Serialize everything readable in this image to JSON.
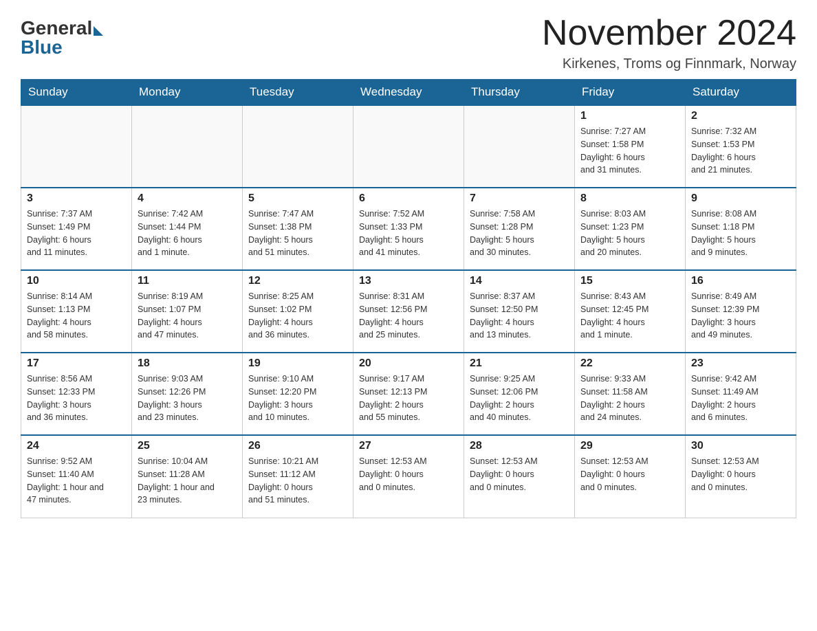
{
  "header": {
    "logo_general": "General",
    "logo_blue": "Blue",
    "month_title": "November 2024",
    "location": "Kirkenes, Troms og Finnmark, Norway"
  },
  "weekdays": [
    "Sunday",
    "Monday",
    "Tuesday",
    "Wednesday",
    "Thursday",
    "Friday",
    "Saturday"
  ],
  "weeks": [
    [
      {
        "day": "",
        "info": ""
      },
      {
        "day": "",
        "info": ""
      },
      {
        "day": "",
        "info": ""
      },
      {
        "day": "",
        "info": ""
      },
      {
        "day": "",
        "info": ""
      },
      {
        "day": "1",
        "info": "Sunrise: 7:27 AM\nSunset: 1:58 PM\nDaylight: 6 hours\nand 31 minutes."
      },
      {
        "day": "2",
        "info": "Sunrise: 7:32 AM\nSunset: 1:53 PM\nDaylight: 6 hours\nand 21 minutes."
      }
    ],
    [
      {
        "day": "3",
        "info": "Sunrise: 7:37 AM\nSunset: 1:49 PM\nDaylight: 6 hours\nand 11 minutes."
      },
      {
        "day": "4",
        "info": "Sunrise: 7:42 AM\nSunset: 1:44 PM\nDaylight: 6 hours\nand 1 minute."
      },
      {
        "day": "5",
        "info": "Sunrise: 7:47 AM\nSunset: 1:38 PM\nDaylight: 5 hours\nand 51 minutes."
      },
      {
        "day": "6",
        "info": "Sunrise: 7:52 AM\nSunset: 1:33 PM\nDaylight: 5 hours\nand 41 minutes."
      },
      {
        "day": "7",
        "info": "Sunrise: 7:58 AM\nSunset: 1:28 PM\nDaylight: 5 hours\nand 30 minutes."
      },
      {
        "day": "8",
        "info": "Sunrise: 8:03 AM\nSunset: 1:23 PM\nDaylight: 5 hours\nand 20 minutes."
      },
      {
        "day": "9",
        "info": "Sunrise: 8:08 AM\nSunset: 1:18 PM\nDaylight: 5 hours\nand 9 minutes."
      }
    ],
    [
      {
        "day": "10",
        "info": "Sunrise: 8:14 AM\nSunset: 1:13 PM\nDaylight: 4 hours\nand 58 minutes."
      },
      {
        "day": "11",
        "info": "Sunrise: 8:19 AM\nSunset: 1:07 PM\nDaylight: 4 hours\nand 47 minutes."
      },
      {
        "day": "12",
        "info": "Sunrise: 8:25 AM\nSunset: 1:02 PM\nDaylight: 4 hours\nand 36 minutes."
      },
      {
        "day": "13",
        "info": "Sunrise: 8:31 AM\nSunset: 12:56 PM\nDaylight: 4 hours\nand 25 minutes."
      },
      {
        "day": "14",
        "info": "Sunrise: 8:37 AM\nSunset: 12:50 PM\nDaylight: 4 hours\nand 13 minutes."
      },
      {
        "day": "15",
        "info": "Sunrise: 8:43 AM\nSunset: 12:45 PM\nDaylight: 4 hours\nand 1 minute."
      },
      {
        "day": "16",
        "info": "Sunrise: 8:49 AM\nSunset: 12:39 PM\nDaylight: 3 hours\nand 49 minutes."
      }
    ],
    [
      {
        "day": "17",
        "info": "Sunrise: 8:56 AM\nSunset: 12:33 PM\nDaylight: 3 hours\nand 36 minutes."
      },
      {
        "day": "18",
        "info": "Sunrise: 9:03 AM\nSunset: 12:26 PM\nDaylight: 3 hours\nand 23 minutes."
      },
      {
        "day": "19",
        "info": "Sunrise: 9:10 AM\nSunset: 12:20 PM\nDaylight: 3 hours\nand 10 minutes."
      },
      {
        "day": "20",
        "info": "Sunrise: 9:17 AM\nSunset: 12:13 PM\nDaylight: 2 hours\nand 55 minutes."
      },
      {
        "day": "21",
        "info": "Sunrise: 9:25 AM\nSunset: 12:06 PM\nDaylight: 2 hours\nand 40 minutes."
      },
      {
        "day": "22",
        "info": "Sunrise: 9:33 AM\nSunset: 11:58 AM\nDaylight: 2 hours\nand 24 minutes."
      },
      {
        "day": "23",
        "info": "Sunrise: 9:42 AM\nSunset: 11:49 AM\nDaylight: 2 hours\nand 6 minutes."
      }
    ],
    [
      {
        "day": "24",
        "info": "Sunrise: 9:52 AM\nSunset: 11:40 AM\nDaylight: 1 hour and\n47 minutes."
      },
      {
        "day": "25",
        "info": "Sunrise: 10:04 AM\nSunset: 11:28 AM\nDaylight: 1 hour and\n23 minutes."
      },
      {
        "day": "26",
        "info": "Sunrise: 10:21 AM\nSunset: 11:12 AM\nDaylight: 0 hours\nand 51 minutes."
      },
      {
        "day": "27",
        "info": "Sunset: 12:53 AM\nDaylight: 0 hours\nand 0 minutes."
      },
      {
        "day": "28",
        "info": "Sunset: 12:53 AM\nDaylight: 0 hours\nand 0 minutes."
      },
      {
        "day": "29",
        "info": "Sunset: 12:53 AM\nDaylight: 0 hours\nand 0 minutes."
      },
      {
        "day": "30",
        "info": "Sunset: 12:53 AM\nDaylight: 0 hours\nand 0 minutes."
      }
    ]
  ]
}
